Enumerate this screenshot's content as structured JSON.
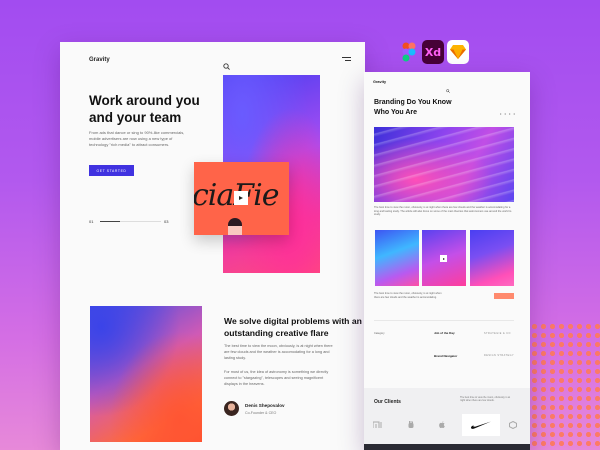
{
  "tools": [
    "figma-icon",
    "xd-icon",
    "sketch-icon"
  ],
  "tools_text": {
    "xd": "Xd"
  },
  "left": {
    "brand": "Gravity",
    "hero": {
      "title": "Work around you and your team",
      "description": "From ads that dance or sing to 90%-like commercials, mobile advertisers are now using a new type of technology \"rich media\" to attract consumers.",
      "cta": "GET STARTED",
      "slider_start": "01",
      "slider_end": "03",
      "slider_progress": 0.33
    },
    "section2": {
      "title": "We solve digital problems with an outstanding creative flare",
      "p1": "The best time to view the moon, obviously, is at night when there are few clouds and the weather is accomodating for a long and lasting study.",
      "p2": "For most of us, the idea of astronomy is something we directly connect to \"stargazing\", telescopes and seeing magnificent displays in the heavens.",
      "author_name": "Denis Shepovalov",
      "author_role": "Co-Founder & CEO"
    },
    "video_script": "ciaFie"
  },
  "right": {
    "brand": "Gravity",
    "title": "Branding Do You Know Who You Are",
    "next": "• • • •",
    "caption1": "The best time to view the moon, obviously, is at night when there are few clouds and the weather is accomodating for a long and lasting study. The article will also focus on some of the main theories that astronomers use around the world to study.",
    "caption2": "The best time to view the moon, obviously, is at night when there are few clouds and the weather is accomodating.",
    "rows": [
      {
        "left": "Category",
        "title": "Job of the Day",
        "sub": "STRATEGIE & CO"
      },
      {
        "left": "",
        "title": "Brand Navigator",
        "sub": "DESIGN STRATEGY"
      }
    ],
    "clients_title": "Our Clients",
    "clients_note": "The best time to view the moon, obviously, is at night when there are few clouds.",
    "client_logos": [
      "mi",
      "apple",
      "nike",
      "adobe",
      "airbnb"
    ]
  }
}
